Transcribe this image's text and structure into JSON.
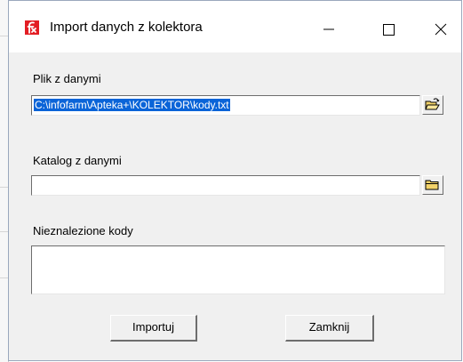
{
  "window": {
    "title": "Import danych z kolektora",
    "controls": {
      "minimize": "minimize-icon",
      "maximize": "maximize-icon",
      "close": "close-icon"
    }
  },
  "fields": {
    "file": {
      "label": "Plik z danymi",
      "value": "C:\\infofarm\\Apteka+\\KOLEKTOR\\kody.txt",
      "button_icon": "open-folder-icon"
    },
    "directory": {
      "label": "Katalog z danymi",
      "value": "",
      "button_icon": "folder-icon"
    },
    "not_found": {
      "label": "Nieznalezione kody",
      "value": ""
    }
  },
  "buttons": {
    "import": "Importuj",
    "close": "Zamknij"
  },
  "colors": {
    "selection": "#0a64d8",
    "app_icon": "#e31e24",
    "dialog_bg": "#f0f0f0"
  }
}
